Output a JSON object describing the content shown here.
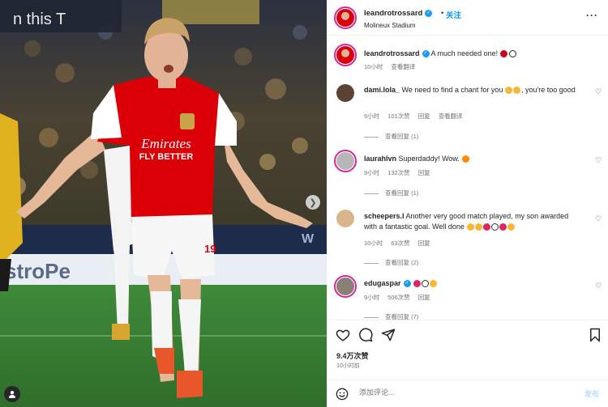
{
  "post": {
    "username": "leandrotrossard",
    "follow_label": "关注",
    "location": "Molineux Stadium",
    "caption": "A much needed one!",
    "caption_time": "10小时",
    "caption_translate": "查看翻译",
    "likes": "9.4万次赞",
    "posted_time": "10小时前",
    "comment_placeholder": "添加评论...",
    "post_label": "发布"
  },
  "photo": {
    "jersey_sponsor_line1": "Emirates",
    "jersey_sponsor_line2": "FLY BETTER",
    "bg_text_left": "n this T",
    "bg_text_board": "stroPe",
    "bg_text_board_right": "W",
    "shorts_number": "19"
  },
  "comments": [
    {
      "username": "dami.lola_",
      "text": "We need to find a chant for you",
      "text_tail": ", you're too good",
      "time": "9小时",
      "likes": "101次赞",
      "reply": "回复",
      "translate": "查看翻译",
      "view_replies": "查看回复 (1)"
    },
    {
      "username": "laurahlvn",
      "text": "Superdaddy! Wow.",
      "time": "9小时",
      "likes": "132次赞",
      "reply": "回复",
      "view_replies": "查看回复 (1)"
    },
    {
      "username": "scheepers.l",
      "text": "Another very good match played, my son awarded with a fantastic goal. Well done",
      "time": "10小时",
      "likes": "63次赞",
      "reply": "回复",
      "view_replies": "查看回复 (2)"
    },
    {
      "username": "edugaspar",
      "text": "",
      "time": "9小时",
      "likes": "506次赞",
      "reply": "回复",
      "view_replies": "查看回复 (7)"
    }
  ],
  "colors": {
    "link_blue": "#0095f6",
    "verified_blue": "#1d9bf0",
    "story_ring": "#d6249f",
    "arsenal_red": "#db0007"
  }
}
